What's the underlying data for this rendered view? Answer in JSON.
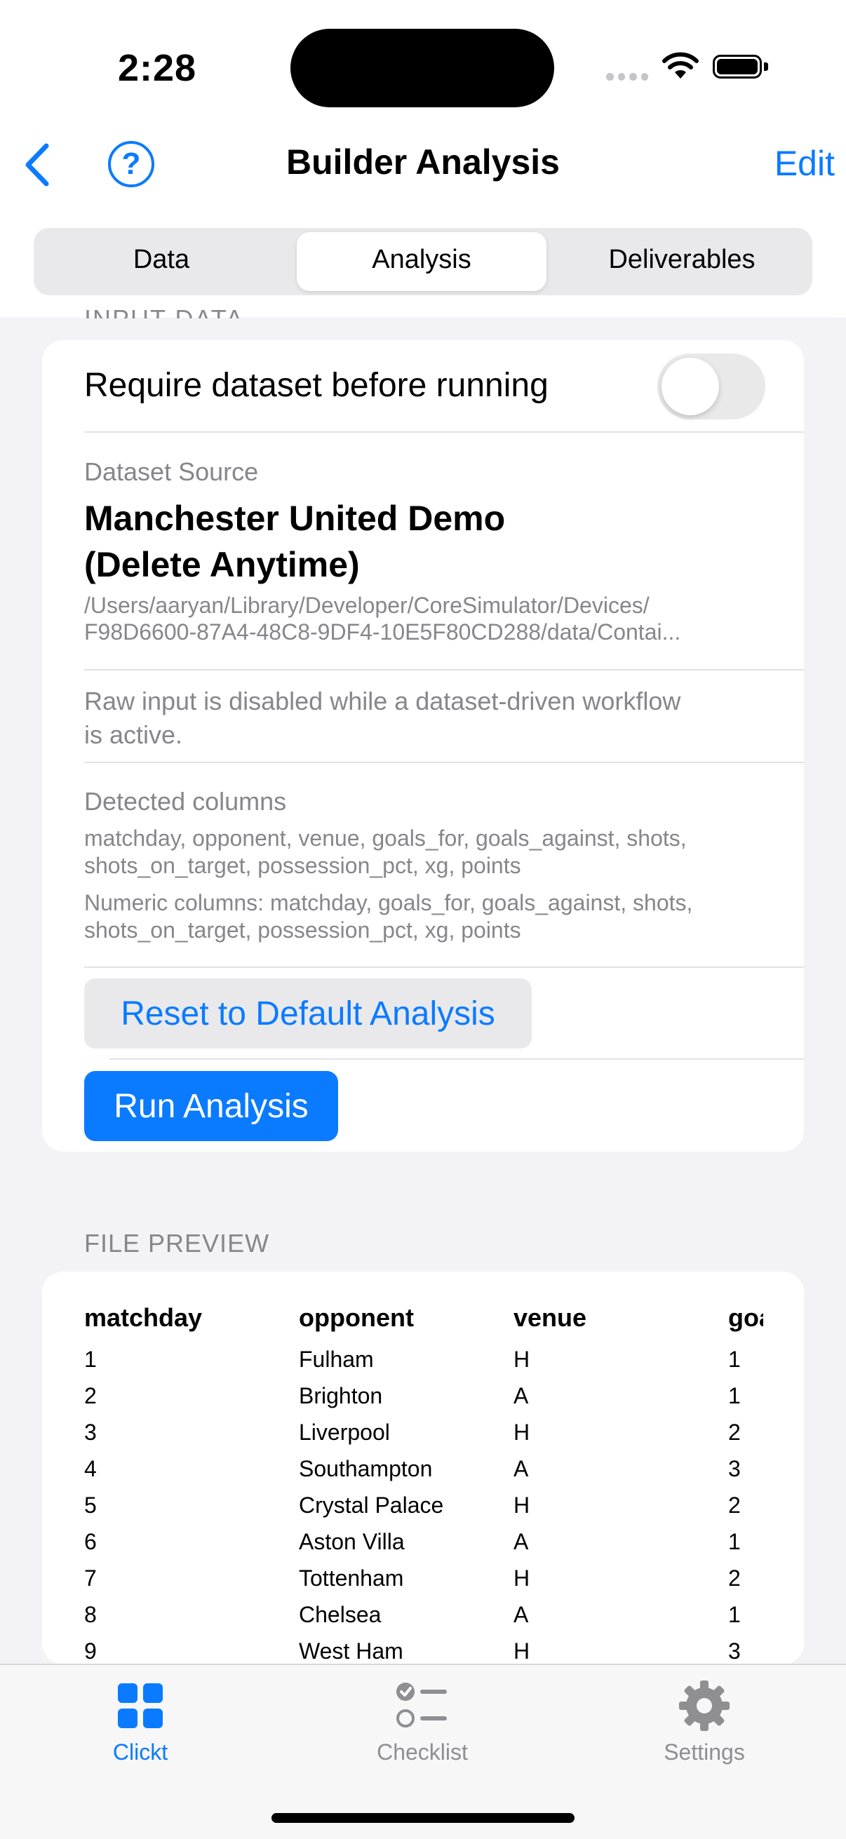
{
  "status_bar": {
    "time": "2:28"
  },
  "nav": {
    "title": "Builder Analysis",
    "edit_label": "Edit",
    "help_glyph": "?"
  },
  "segments": [
    {
      "label": "Data",
      "selected": false
    },
    {
      "label": "Analysis",
      "selected": true
    },
    {
      "label": "Deliverables",
      "selected": false
    }
  ],
  "input_section": {
    "header": "INPUT DATA",
    "require_label": "Require dataset before running",
    "require_on": false,
    "dataset_source_caption": "Dataset Source",
    "dataset_name_line1": "Manchester United Demo",
    "dataset_name_line2": "(Delete Anytime)",
    "path_line1": "/Users/aaryan/Library/Developer/CoreSimulator/Devices/",
    "path_line2": "F98D6600-87A4-48C8-9DF4-10E5F80CD288/data/Contai...",
    "raw_note_line1": "Raw input is disabled while a dataset-driven workflow",
    "raw_note_line2": "is active.",
    "detected_title": "Detected columns",
    "detected_line1": "matchday, opponent, venue, goals_for, goals_against, shots,",
    "detected_line2": "shots_on_target, possession_pct, xg, points",
    "numeric_line1": "Numeric columns: matchday, goals_for, goals_against, shots,",
    "numeric_line2": "shots_on_target, possession_pct, xg, points",
    "reset_label": "Reset to Default Analysis",
    "run_label": "Run Analysis"
  },
  "file_preview": {
    "header": "FILE PREVIEW",
    "columns": [
      "matchday",
      "opponent",
      "venue",
      "goa"
    ],
    "rows": [
      [
        "1",
        "Fulham",
        "H",
        "1"
      ],
      [
        "2",
        "Brighton",
        "A",
        "1"
      ],
      [
        "3",
        "Liverpool",
        "H",
        "2"
      ],
      [
        "4",
        "Southampton",
        "A",
        "3"
      ],
      [
        "5",
        "Crystal Palace",
        "H",
        "2"
      ],
      [
        "6",
        "Aston Villa",
        "A",
        "1"
      ],
      [
        "7",
        "Tottenham",
        "H",
        "2"
      ],
      [
        "8",
        "Chelsea",
        "A",
        "1"
      ],
      [
        "9",
        "West Ham",
        "H",
        "3"
      ]
    ]
  },
  "tab_bar": {
    "items": [
      {
        "label": "Clickt",
        "icon": "grid-icon",
        "active": true
      },
      {
        "label": "Checklist",
        "icon": "checklist-icon",
        "active": false
      },
      {
        "label": "Settings",
        "icon": "gear-icon",
        "active": false
      }
    ]
  },
  "colors": {
    "accent": "#0a7bff",
    "secondary_text": "#86868b",
    "background": "#f2f2f7",
    "inactive_tab": "#8e8e93"
  }
}
